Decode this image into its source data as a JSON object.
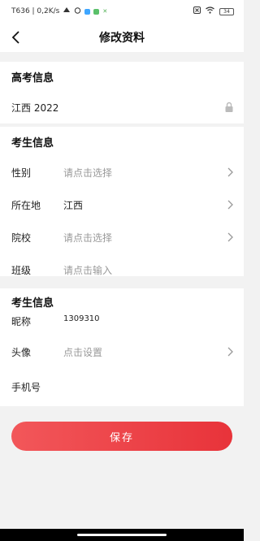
{
  "status_bar": {
    "left_text": "T636 | 0,2K/s",
    "battery": "34"
  },
  "header": {
    "title": "修改资料"
  },
  "gaokao": {
    "section_title": "高考信息",
    "value": "江西 2022"
  },
  "student": {
    "section_title": "考生信息",
    "rows": [
      {
        "label": "性别",
        "value": "请点击选择"
      },
      {
        "label": "所在地",
        "value": "江西"
      },
      {
        "label": "院校",
        "value": "请点击选择"
      },
      {
        "label": "班级",
        "value": "请点击输入"
      }
    ]
  },
  "profile": {
    "section_title": "考生信息",
    "rows": [
      {
        "label": "昵称",
        "value": "1309310"
      },
      {
        "label": "头像",
        "value": "点击设置"
      },
      {
        "label": "手机号",
        "value": ""
      }
    ]
  },
  "save_button": {
    "label": "保存"
  },
  "colors": {
    "accent": "#e8333a",
    "background": "#f2f2f2",
    "placeholder": "#999999"
  }
}
